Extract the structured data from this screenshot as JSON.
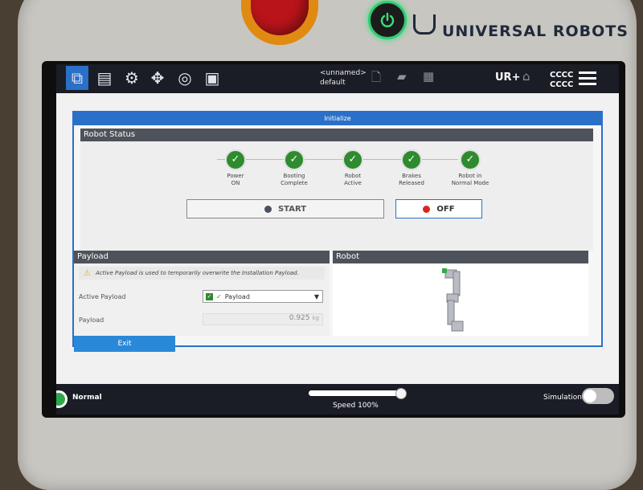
{
  "device": {
    "brand_text": "UNIVERSAL ROBOTS"
  },
  "topbar": {
    "program_name": "<unnamed>",
    "installation_name": "default",
    "tabs": [
      {
        "icon": "run-icon",
        "active": true
      },
      {
        "icon": "program-icon",
        "active": false
      },
      {
        "icon": "installation-icon",
        "active": false
      },
      {
        "icon": "move-icon",
        "active": false
      },
      {
        "icon": "io-icon",
        "active": false
      },
      {
        "icon": "log-icon",
        "active": false
      }
    ],
    "file_actions": [
      "new-icon",
      "open-icon",
      "save-icon"
    ],
    "urplus_label": "UR+",
    "robot_code_1": "CCCC",
    "robot_code_2": "CCCC"
  },
  "dialog": {
    "title": "Initialize",
    "robot_status": {
      "header": "Robot Status",
      "steps": [
        {
          "line1": "Power",
          "line2": "ON"
        },
        {
          "line1": "Booting",
          "line2": "Complete"
        },
        {
          "line1": "Robot",
          "line2": "Active"
        },
        {
          "line1": "Brakes",
          "line2": "Released"
        },
        {
          "line1": "Robot in",
          "line2": "Normal Mode"
        }
      ],
      "start_label": "START",
      "off_label": "OFF"
    },
    "payload": {
      "header": "Payload",
      "warning": "Active Payload is used to temporarily overwrite the Installation Payload.",
      "active_payload_label": "Active Payload",
      "active_payload_value": "Payload",
      "payload_label": "Payload",
      "payload_value": "0.925",
      "payload_unit": "kg"
    },
    "robot": {
      "header": "Robot"
    },
    "exit_label": "Exit"
  },
  "bottombar": {
    "status": "Normal",
    "speed_label": "Speed 100%",
    "speed_fraction": 1.0,
    "simulation_label": "Simulation"
  },
  "colors": {
    "accent": "#2a70c8",
    "ok_green": "#2e8b2e",
    "off_red": "#d8261c",
    "start_gray": "#4a5060"
  }
}
